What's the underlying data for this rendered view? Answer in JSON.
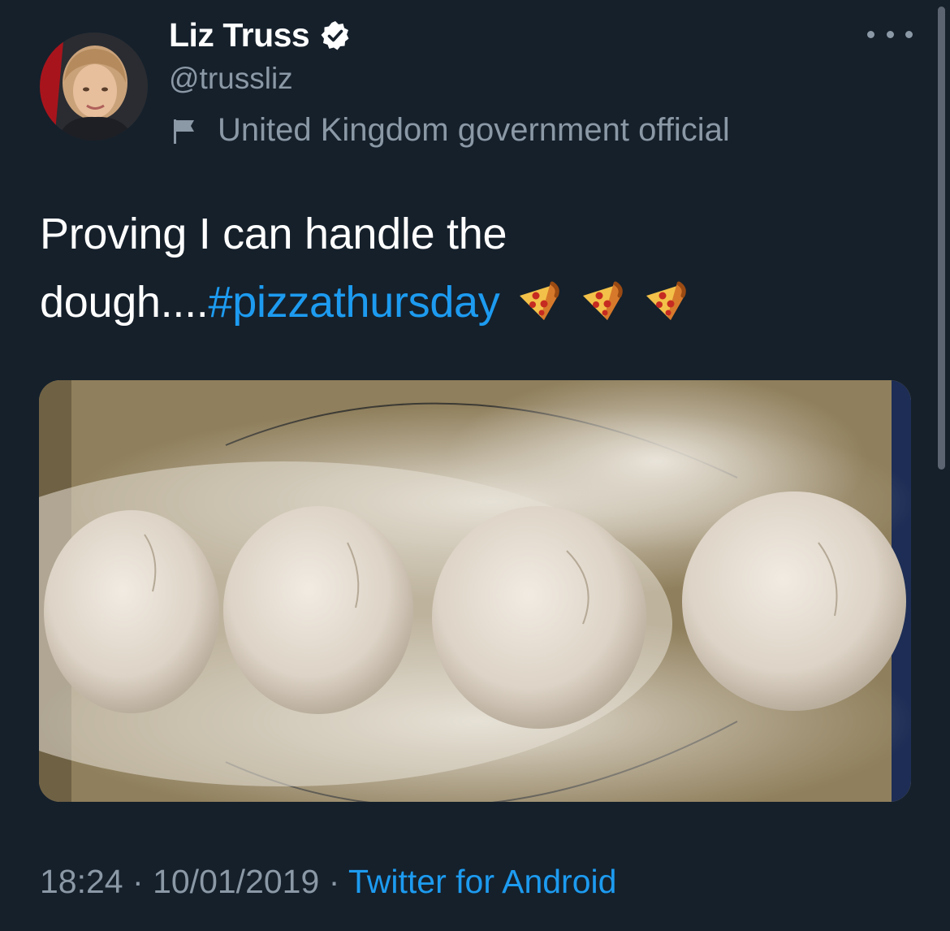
{
  "tweet": {
    "author": {
      "name": "Liz Truss",
      "handle": "@trussliz",
      "label": "United Kingdom government official",
      "verified": true
    },
    "text_before": "Proving I can handle the dough....",
    "hashtag": "#pizzathursday",
    "emoji": [
      "pizza-icon",
      "pizza-icon",
      "pizza-icon"
    ],
    "time": "18:24",
    "separator": "·",
    "date": "10/01/2019",
    "source": "Twitter for Android"
  },
  "colors": {
    "background": "#15202b",
    "text": "#ffffff",
    "secondary_text": "#8b98a5",
    "link": "#1d9bf0"
  }
}
